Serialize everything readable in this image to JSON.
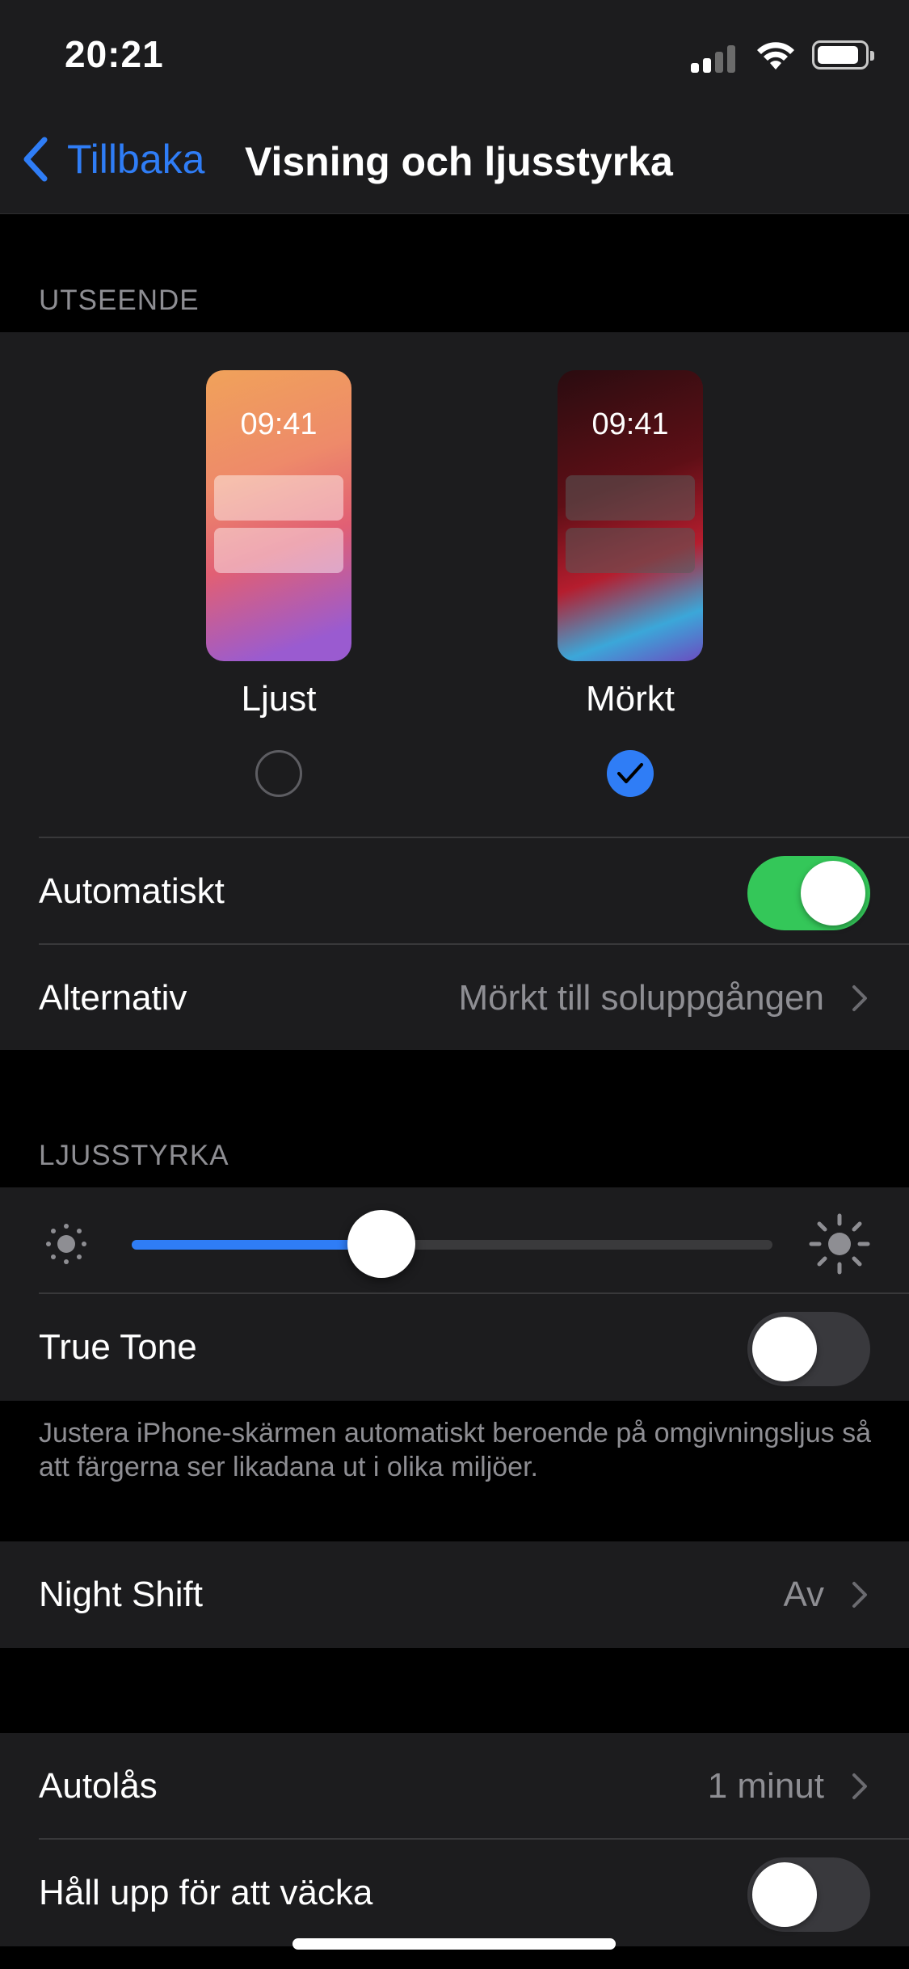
{
  "status_bar": {
    "time": "20:21"
  },
  "nav": {
    "back_label": "Tillbaka",
    "title": "Visning och ljusstyrka"
  },
  "appearance": {
    "header": "UTSEENDE",
    "light": {
      "preview_time": "09:41",
      "label": "Ljust",
      "selected": false
    },
    "dark": {
      "preview_time": "09:41",
      "label": "Mörkt",
      "selected": true
    },
    "automatic": {
      "label": "Automatiskt",
      "on": true
    },
    "options": {
      "label": "Alternativ",
      "value": "Mörkt till soluppgången"
    }
  },
  "brightness": {
    "header": "LJUSSTYRKA",
    "level": 0.39,
    "true_tone": {
      "label": "True Tone",
      "on": false
    },
    "footnote": "Justera iPhone-skärmen automatiskt beroende på omgivningsljus så att färgerna ser likadana ut i olika miljöer."
  },
  "night_shift": {
    "label": "Night Shift",
    "value": "Av"
  },
  "auto_lock": {
    "label": "Autolås",
    "value": "1 minut"
  },
  "raise_to_wake": {
    "label": "Håll upp för att väcka",
    "on": false
  },
  "colors": {
    "accent": "#2f7df6",
    "toggle_on": "#34c759",
    "cell_bg": "#1c1c1e",
    "background": "#000000"
  }
}
